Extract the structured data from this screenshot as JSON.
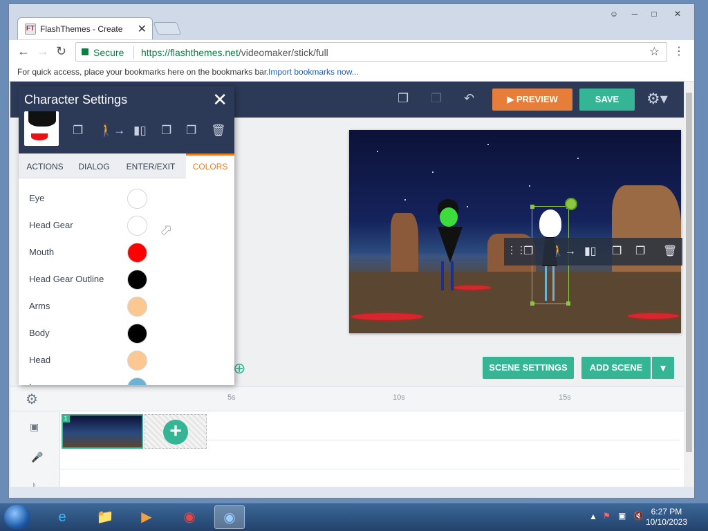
{
  "browser": {
    "tab_title": "FlashThemes - Create",
    "tab_favicon": "FT",
    "close_tab": "✕",
    "secure_label": "Secure",
    "url_host": "https://flashthemes.net",
    "url_path": "/videomaker/stick/full",
    "bookmarks_prompt": "For quick access, place your bookmarks here on the bookmarks bar.",
    "import_bookmarks": "Import bookmarks now..."
  },
  "header": {
    "preview_label": "PREVIEW",
    "save_label": "SAVE"
  },
  "character_panel": {
    "title": "Character Settings",
    "tabs": [
      {
        "label": "ACTIONS"
      },
      {
        "label": "DIALOG"
      },
      {
        "label": "ENTER/EXIT"
      },
      {
        "label": "COLORS",
        "active": true
      }
    ],
    "colors": [
      {
        "label": "Eye",
        "color": "#ffffff"
      },
      {
        "label": "Head Gear",
        "color": "#ffffff"
      },
      {
        "label": "Mouth",
        "color": "#ff0000"
      },
      {
        "label": "Head Gear Outline",
        "color": "#000000"
      },
      {
        "label": "Arms",
        "color": "#fcc891"
      },
      {
        "label": "Body",
        "color": "#000000"
      },
      {
        "label": "Head",
        "color": "#fcc891"
      },
      {
        "label": "L",
        "color": "#6bb3d4"
      }
    ]
  },
  "scene_buttons": {
    "scene_settings": "SCENE SETTINGS",
    "add_scene": "ADD SCENE"
  },
  "timeline": {
    "ticks": [
      "5s",
      "10s",
      "15s"
    ],
    "scene_number": "1"
  },
  "taskbar": {
    "time": "6:27 PM",
    "date": "10/10/2023"
  },
  "colors": {
    "accent_green": "#35b594",
    "preview_orange": "#e67e3a",
    "header_navy": "#2c3a58",
    "active_tab_orange": "#e67e22"
  }
}
